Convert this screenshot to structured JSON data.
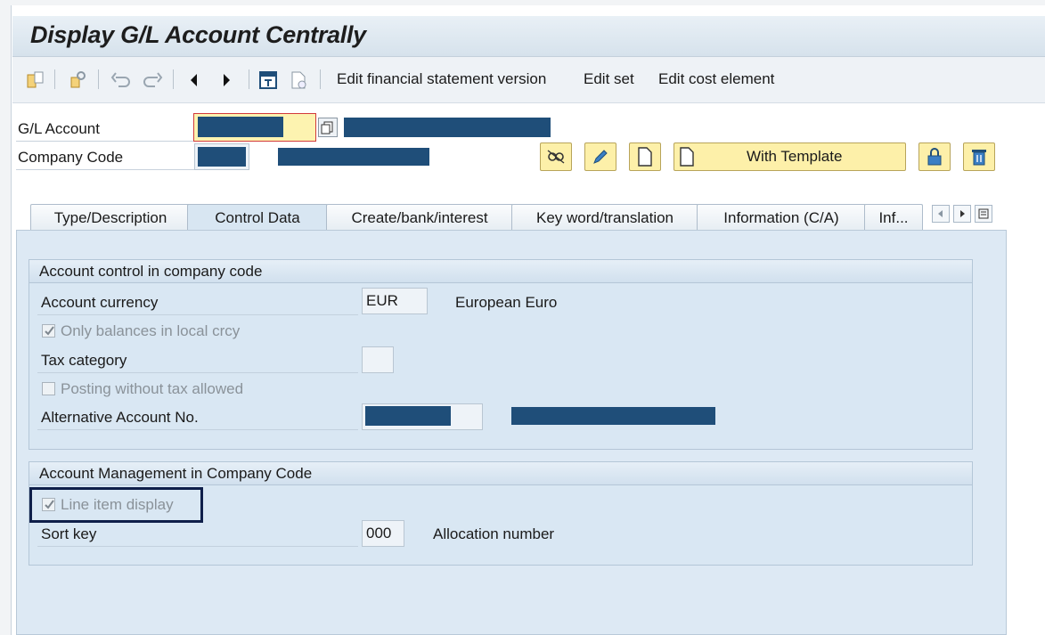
{
  "title": "Display G/L Account Centrally",
  "toolbar": {
    "links": [
      "Edit financial statement version",
      "Edit set",
      "Edit cost element"
    ],
    "icons": [
      "other-object-icon",
      "where-used-icon",
      "undo-icon",
      "redo-icon",
      "previous-icon",
      "next-icon",
      "overview-icon",
      "document-icon"
    ]
  },
  "header": {
    "gl_account_label": "G/L Account",
    "company_code_label": "Company Code",
    "with_template_label": "With Template"
  },
  "tabs": [
    {
      "label": "Type/Description"
    },
    {
      "label": "Control Data"
    },
    {
      "label": "Create/bank/interest"
    },
    {
      "label": "Key word/translation"
    },
    {
      "label": "Information (C/A)"
    },
    {
      "label": "Inf..."
    }
  ],
  "active_tab": "Control Data",
  "group1": {
    "title": "Account control in company code",
    "account_currency_label": "Account currency",
    "account_currency_value": "EUR",
    "account_currency_desc": "European Euro",
    "only_balances_label": "Only balances in local crcy",
    "tax_category_label": "Tax category",
    "posting_without_tax_label": "Posting without tax allowed",
    "alt_account_label": "Alternative Account No."
  },
  "group2": {
    "title": "Account Management in Company Code",
    "line_item_label": "Line item display",
    "sort_key_label": "Sort key",
    "sort_key_value": "000",
    "sort_key_desc": "Allocation number"
  },
  "colors": {
    "redaction": "#1f4e79",
    "highlight_box": "#0f1f4a",
    "button_yellow": "#fdf0a9"
  }
}
